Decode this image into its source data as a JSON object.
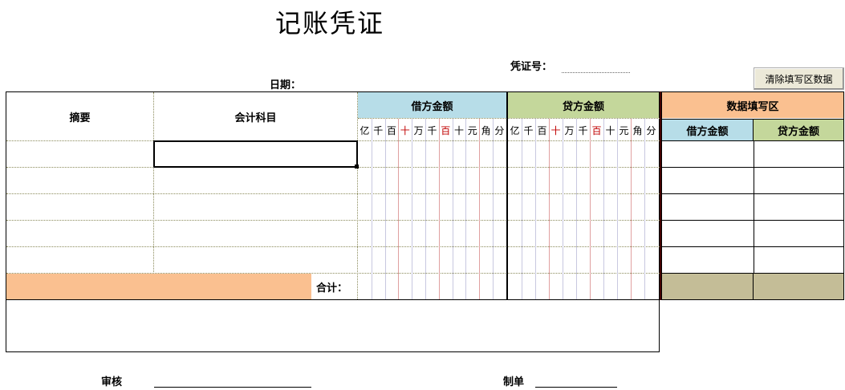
{
  "title": "记账凭证",
  "voucher_no_label": "凭证号：",
  "date_label": "日期：",
  "clear_button": "清除填写区数据",
  "headers": {
    "summary": "摘要",
    "account": "会计科目",
    "debit": "借方金额",
    "credit": "贷方金额",
    "entry_area": "数据填写区",
    "entry_debit": "借方金额",
    "entry_credit": "贷方金额"
  },
  "digit_units": [
    "亿",
    "千",
    "百",
    "十",
    "万",
    "千",
    "百",
    "十",
    "元",
    "角",
    "分"
  ],
  "total_label": "合计：",
  "audit_label": "审核",
  "maker_label": "制单",
  "colors": {
    "debit_header": "#b7dde8",
    "credit_header": "#c4d79b",
    "entry_header": "#fac090",
    "total_row": "#fac090",
    "entry_total": "#c4bd97",
    "digit_red": "#c00000"
  }
}
